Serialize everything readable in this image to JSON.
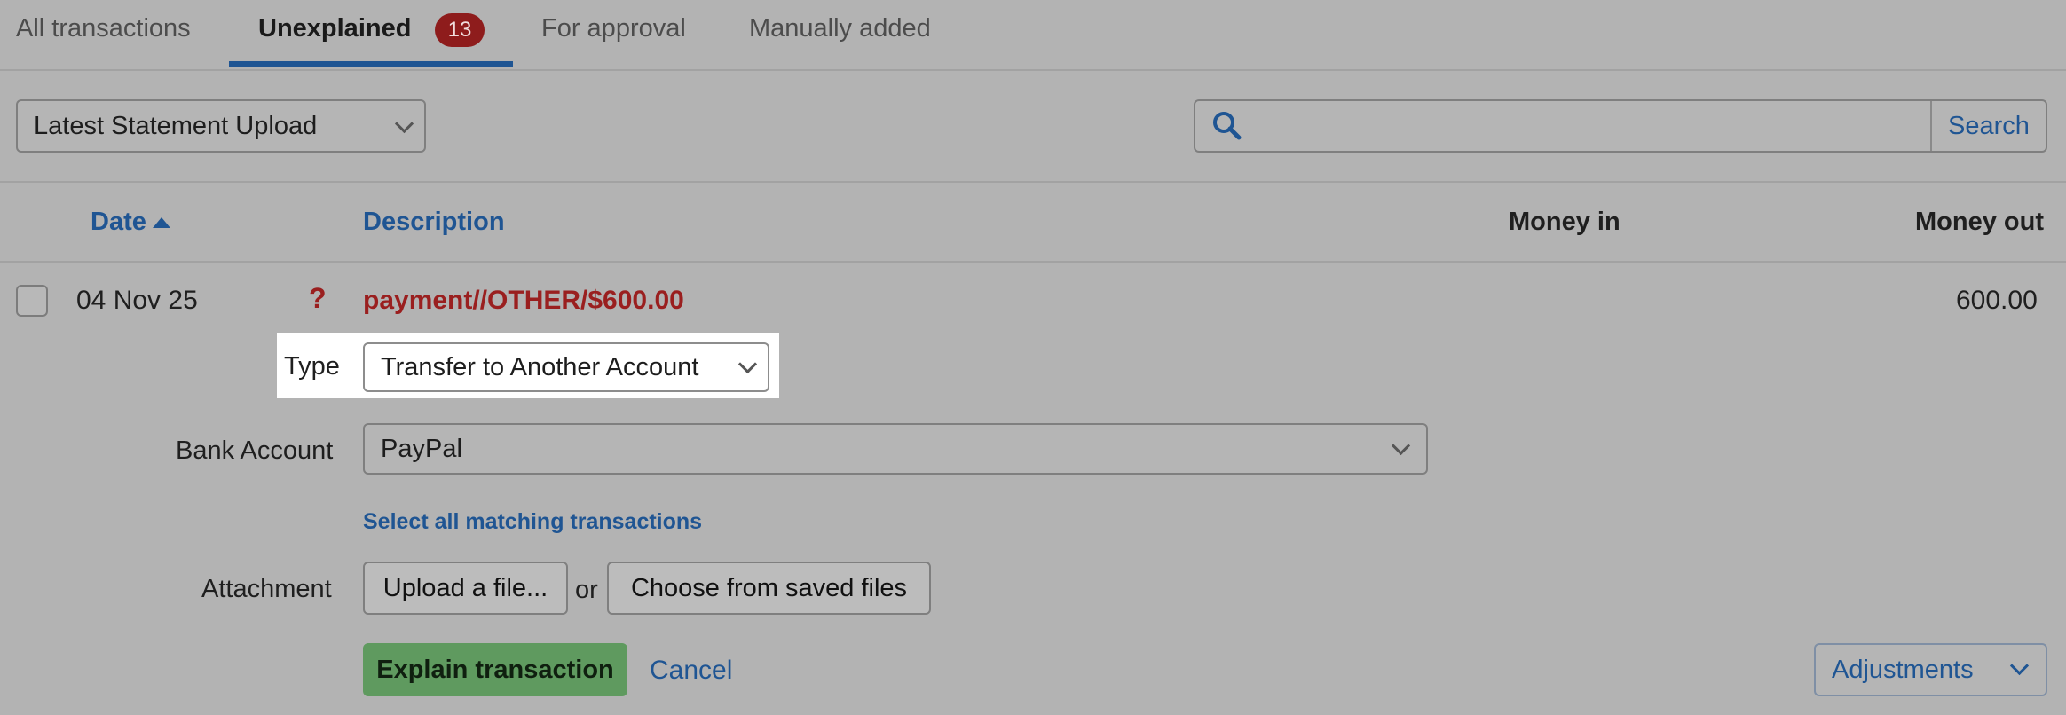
{
  "tabs": [
    {
      "label": "All transactions"
    },
    {
      "label": "Unexplained",
      "badge": "13",
      "active": true
    },
    {
      "label": "For approval"
    },
    {
      "label": "Manually added"
    }
  ],
  "filter": {
    "statement_select": "Latest Statement Upload",
    "search_placeholder": "",
    "search_button": "Search"
  },
  "table": {
    "headers": {
      "date": "Date",
      "description": "Description",
      "money_in": "Money in",
      "money_out": "Money out"
    },
    "row": {
      "date": "04 Nov 25",
      "status_icon": "?",
      "description": "payment//OTHER/$600.00",
      "money_in": "",
      "money_out": "600.00"
    }
  },
  "explain_form": {
    "type_label": "Type",
    "type_value": "Transfer to Another Account",
    "bank_account_label": "Bank Account",
    "bank_account_value": "PayPal",
    "select_all_link": "Select all matching transactions",
    "attachment_label": "Attachment",
    "upload_button": "Upload a file...",
    "or_text": "or",
    "choose_button": "Choose from saved files",
    "explain_button": "Explain transaction",
    "cancel_link": "Cancel",
    "adjustments_button": "Adjustments"
  },
  "colors": {
    "accent": "#1f5593",
    "badge": "#8e1c1c",
    "unexplained_text": "#9a1f1f",
    "primary_button": "#5f9a5f"
  }
}
